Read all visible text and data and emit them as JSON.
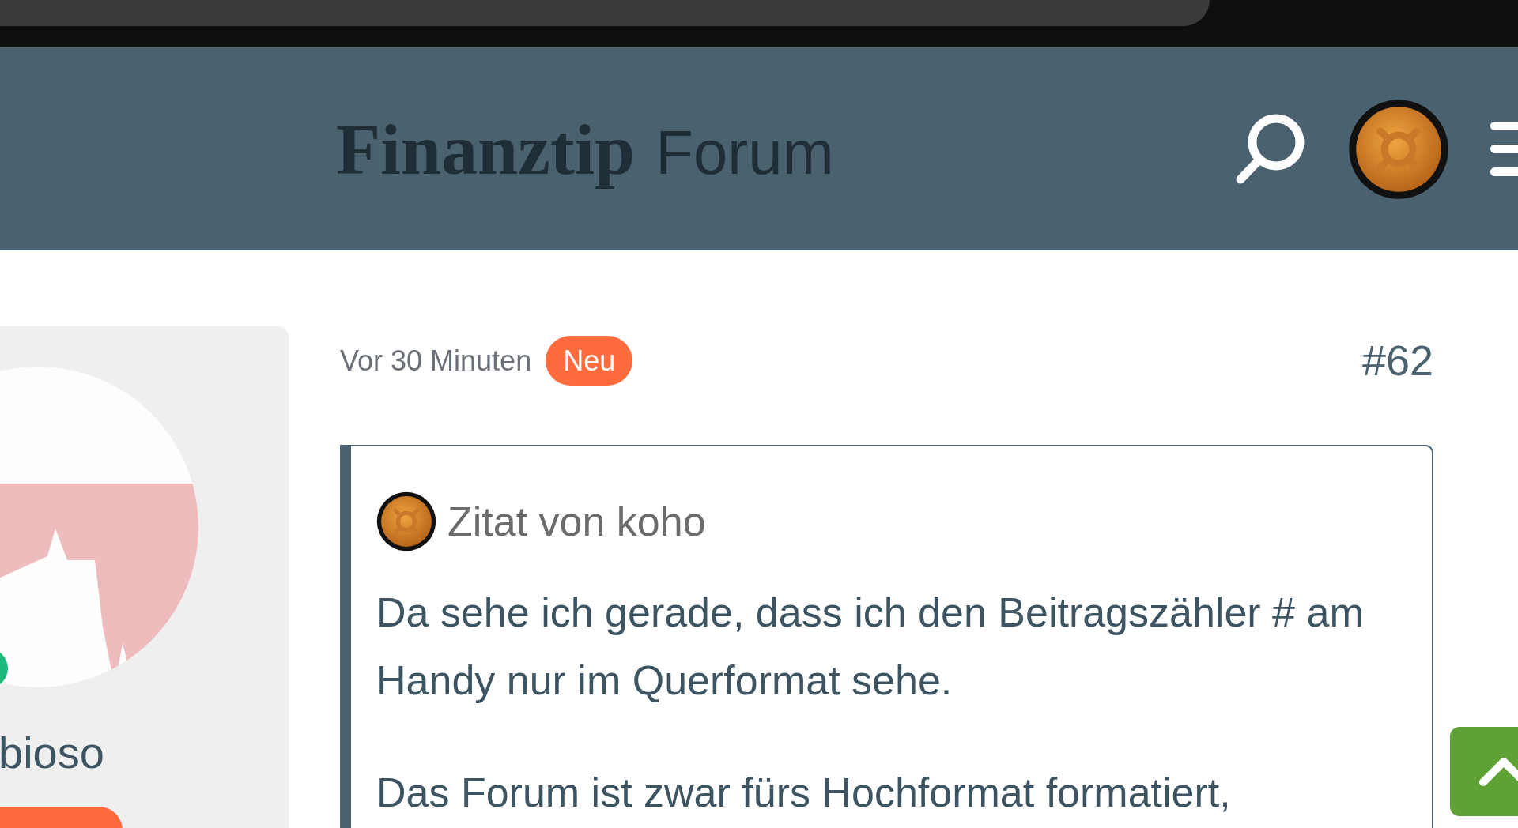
{
  "header": {
    "logo_bold": "Finanztip",
    "logo_light": "Forum"
  },
  "author": {
    "name": "bioso",
    "online": true
  },
  "post": {
    "time": "Vor 30 Minuten",
    "badge": "Neu",
    "number": "#62",
    "quote": {
      "title": "Zitat von koho",
      "paragraphs": [
        "Da sehe ich gerade, dass ich den Beitragszähler # am Handy nur im Querformat sehe.",
        "Das Forum ist zwar fürs Hochformat formatiert,"
      ]
    }
  }
}
